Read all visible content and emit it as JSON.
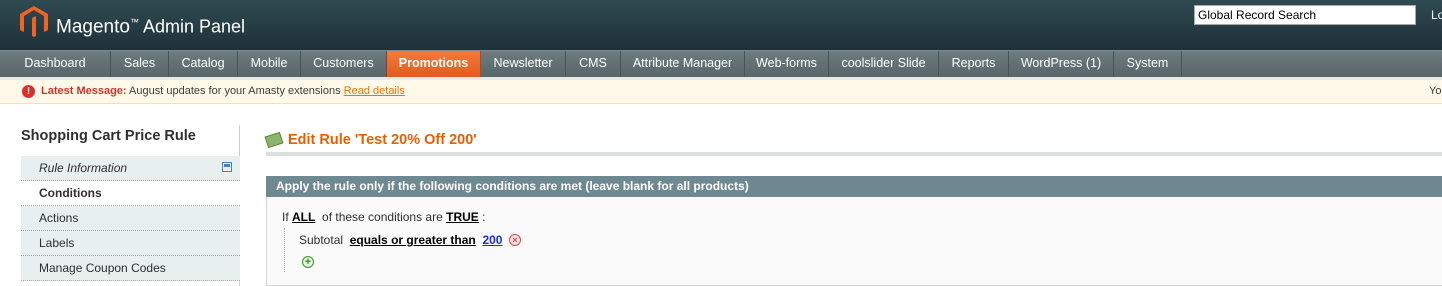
{
  "header": {
    "brand_name": "Magento",
    "brand_tm": "™",
    "brand_suffix": "Admin Panel",
    "search_value": "Global Record Search",
    "logout_partial": "Lo"
  },
  "nav": {
    "items": [
      {
        "label": "Dashboard"
      },
      {
        "label": "Sales"
      },
      {
        "label": "Catalog"
      },
      {
        "label": "Mobile"
      },
      {
        "label": "Customers"
      },
      {
        "label": "Promotions",
        "active": true
      },
      {
        "label": "Newsletter"
      },
      {
        "label": "CMS"
      },
      {
        "label": "Attribute Manager"
      },
      {
        "label": "Web-forms"
      },
      {
        "label": "coolslider Slide"
      },
      {
        "label": "Reports"
      },
      {
        "label": "WordPress (1)"
      },
      {
        "label": "System"
      }
    ]
  },
  "notice": {
    "icon_glyph": "!",
    "label": "Latest Message:",
    "message": "August updates for your Amasty extensions",
    "link": "Read details",
    "right_partial": "Yo"
  },
  "sidebar": {
    "title": "Shopping Cart Price Rule",
    "tabs": [
      {
        "label": "Rule Information"
      },
      {
        "label": "Conditions"
      },
      {
        "label": "Actions"
      },
      {
        "label": "Labels"
      },
      {
        "label": "Manage Coupon Codes"
      }
    ]
  },
  "main": {
    "title": "Edit Rule 'Test 20% Off 200'",
    "fieldset_title": "Apply the rule only if the following conditions are met (leave blank for all products)",
    "condition": {
      "prefix": "If",
      "aggregator": "ALL",
      "middle": "of these conditions are",
      "value": "TRUE",
      "suffix": ":",
      "item_attribute": "Subtotal",
      "item_operator": "equals or greater than",
      "item_value": "200",
      "remove_glyph": "×",
      "add_glyph": "+"
    }
  },
  "colors": {
    "header_bg": "#243a41",
    "nav_bg": "#64737a",
    "nav_active": "#eb6625",
    "title_orange": "#eb5e00",
    "fieldset_head": "#6f8992",
    "link_blue": "#1a2ddb"
  }
}
